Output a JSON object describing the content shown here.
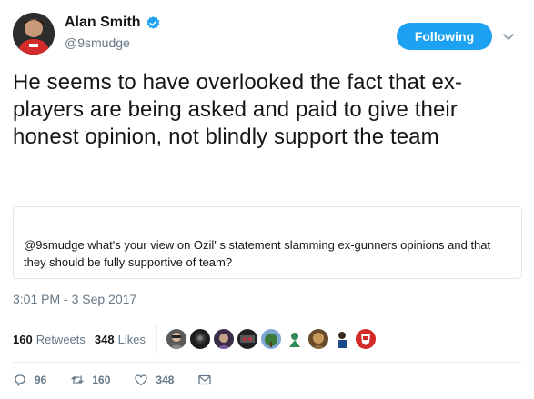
{
  "user": {
    "display_name": "Alan Smith",
    "handle": "@9smudge",
    "verified_icon": "verified-badge-icon",
    "avatar_icon": "profile-avatar"
  },
  "follow_button": {
    "label": "Following"
  },
  "menu_icon": "chevron-down-icon",
  "tweet": {
    "text": "He seems to have overlooked the fact that ex-players are being asked and paid to give their honest opinion, not blindly support the team"
  },
  "quoted": {
    "text": "@9smudge what's your view on Ozil' s statement slamming ex-gunners opinions and that they should be fully supportive of team?"
  },
  "timestamp": "3:01 PM - 3 Sep 2017",
  "stats": {
    "retweets_count": "160",
    "retweets_label": "Retweets",
    "likes_count": "348",
    "likes_label": "Likes"
  },
  "liker_avatars": [
    "avatar-1",
    "avatar-2",
    "avatar-3",
    "avatar-4",
    "avatar-5",
    "avatar-6",
    "avatar-7",
    "avatar-8",
    "avatar-9"
  ],
  "actions": {
    "reply_count": "96",
    "retweet_count": "160",
    "like_count": "348"
  },
  "colors": {
    "accent": "#1da1f2",
    "text": "#14171a",
    "secondary": "#657786",
    "border": "#e1e8ed"
  }
}
